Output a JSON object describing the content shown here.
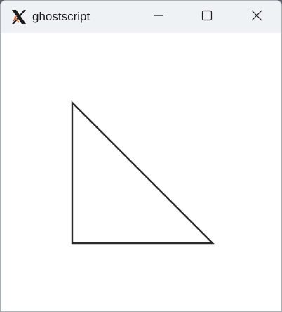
{
  "window": {
    "title": "ghostscript",
    "app_icon": "x-window-system-icon",
    "controls": {
      "minimize_icon": "minimize-icon",
      "maximize_icon": "maximize-icon",
      "close_icon": "close-icon"
    }
  },
  "canvas": {
    "shape": "right-triangle",
    "stroke_color": "#2b2b2b",
    "background_color": "#ffffff"
  }
}
